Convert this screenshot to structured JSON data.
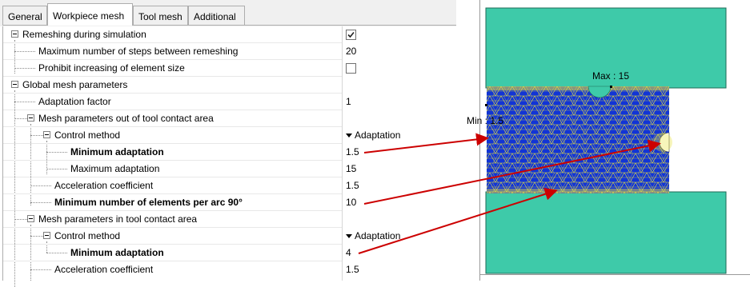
{
  "tabs": [
    "General",
    "Workpiece mesh",
    "Tool mesh",
    "Additional"
  ],
  "rows": [
    {
      "label": "Remeshing during simulation",
      "value": "",
      "checkbox": "checked"
    },
    {
      "label": "Maximum number of steps between remeshing",
      "value": "20"
    },
    {
      "label": "Prohibit increasing of element size",
      "value": "",
      "checkbox": "unchecked"
    },
    {
      "label": "Global mesh parameters",
      "value": ""
    },
    {
      "label": "Adaptation factor",
      "value": "1"
    },
    {
      "label": "Mesh parameters out of tool contact area",
      "value": ""
    },
    {
      "label": "Control method",
      "value": "Adaptation"
    },
    {
      "label": "Minimum adaptation",
      "value": "1.5"
    },
    {
      "label": "Maximum adaptation",
      "value": "15"
    },
    {
      "label": "Acceleration coefficient",
      "value": "1.5"
    },
    {
      "label": "Minimum number of elements per arc 90°",
      "value": "10"
    },
    {
      "label": "Mesh parameters in tool contact area",
      "value": ""
    },
    {
      "label": "Control method",
      "value": "Adaptation"
    },
    {
      "label": "Minimum adaptation",
      "value": "4"
    },
    {
      "label": "Acceleration coefficient",
      "value": "1.5"
    }
  ],
  "viewer": {
    "max_label": "Max : 15",
    "min_label": "Min : 1.5"
  },
  "colors": {
    "tool": "#3ecaa9",
    "mesh": "#1134d6",
    "mesh_lines": "#e8e23a",
    "arrow": "#cc0000"
  }
}
